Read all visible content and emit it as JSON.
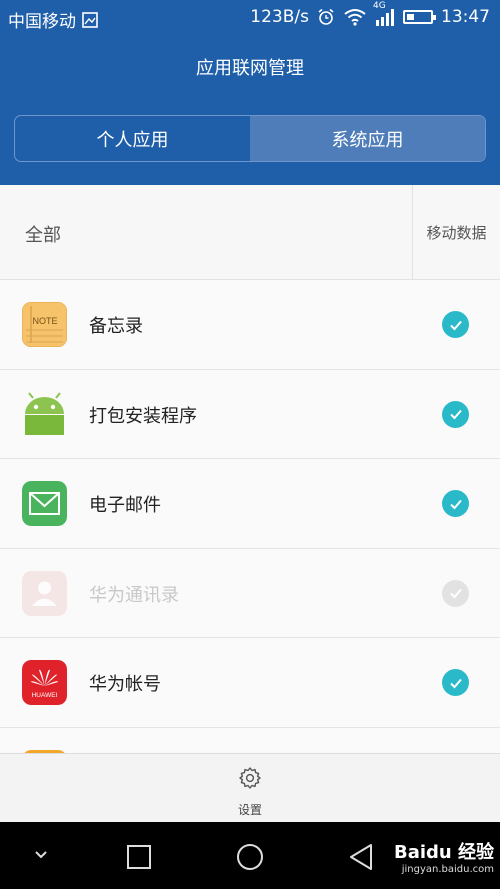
{
  "status_bar": {
    "carrier": "中国移动",
    "speed": "123B/s",
    "network": "4G",
    "time": "13:47"
  },
  "header": {
    "title": "应用联网管理"
  },
  "tabs": [
    {
      "label": "个人应用",
      "active": false
    },
    {
      "label": "系统应用",
      "active": true
    }
  ],
  "list_header": {
    "all_label": "全部",
    "column_label": "移动数据"
  },
  "apps": [
    {
      "name": "备忘录",
      "icon": "note-icon",
      "mobile_data": true,
      "enabled": true
    },
    {
      "name": "打包安装程序",
      "icon": "android-icon",
      "mobile_data": true,
      "enabled": true
    },
    {
      "name": "电子邮件",
      "icon": "mail-icon",
      "mobile_data": true,
      "enabled": true
    },
    {
      "name": "华为通讯录",
      "icon": "contacts-icon",
      "mobile_data": true,
      "enabled": false
    },
    {
      "name": "华为帐号",
      "icon": "huawei-icon",
      "mobile_data": true,
      "enabled": true
    }
  ],
  "bottom_bar": {
    "settings_label": "设置"
  },
  "colors": {
    "header_bg": "#1f5faa",
    "check_on": "#2ab9c8",
    "check_disabled": "#e2e2e2"
  }
}
